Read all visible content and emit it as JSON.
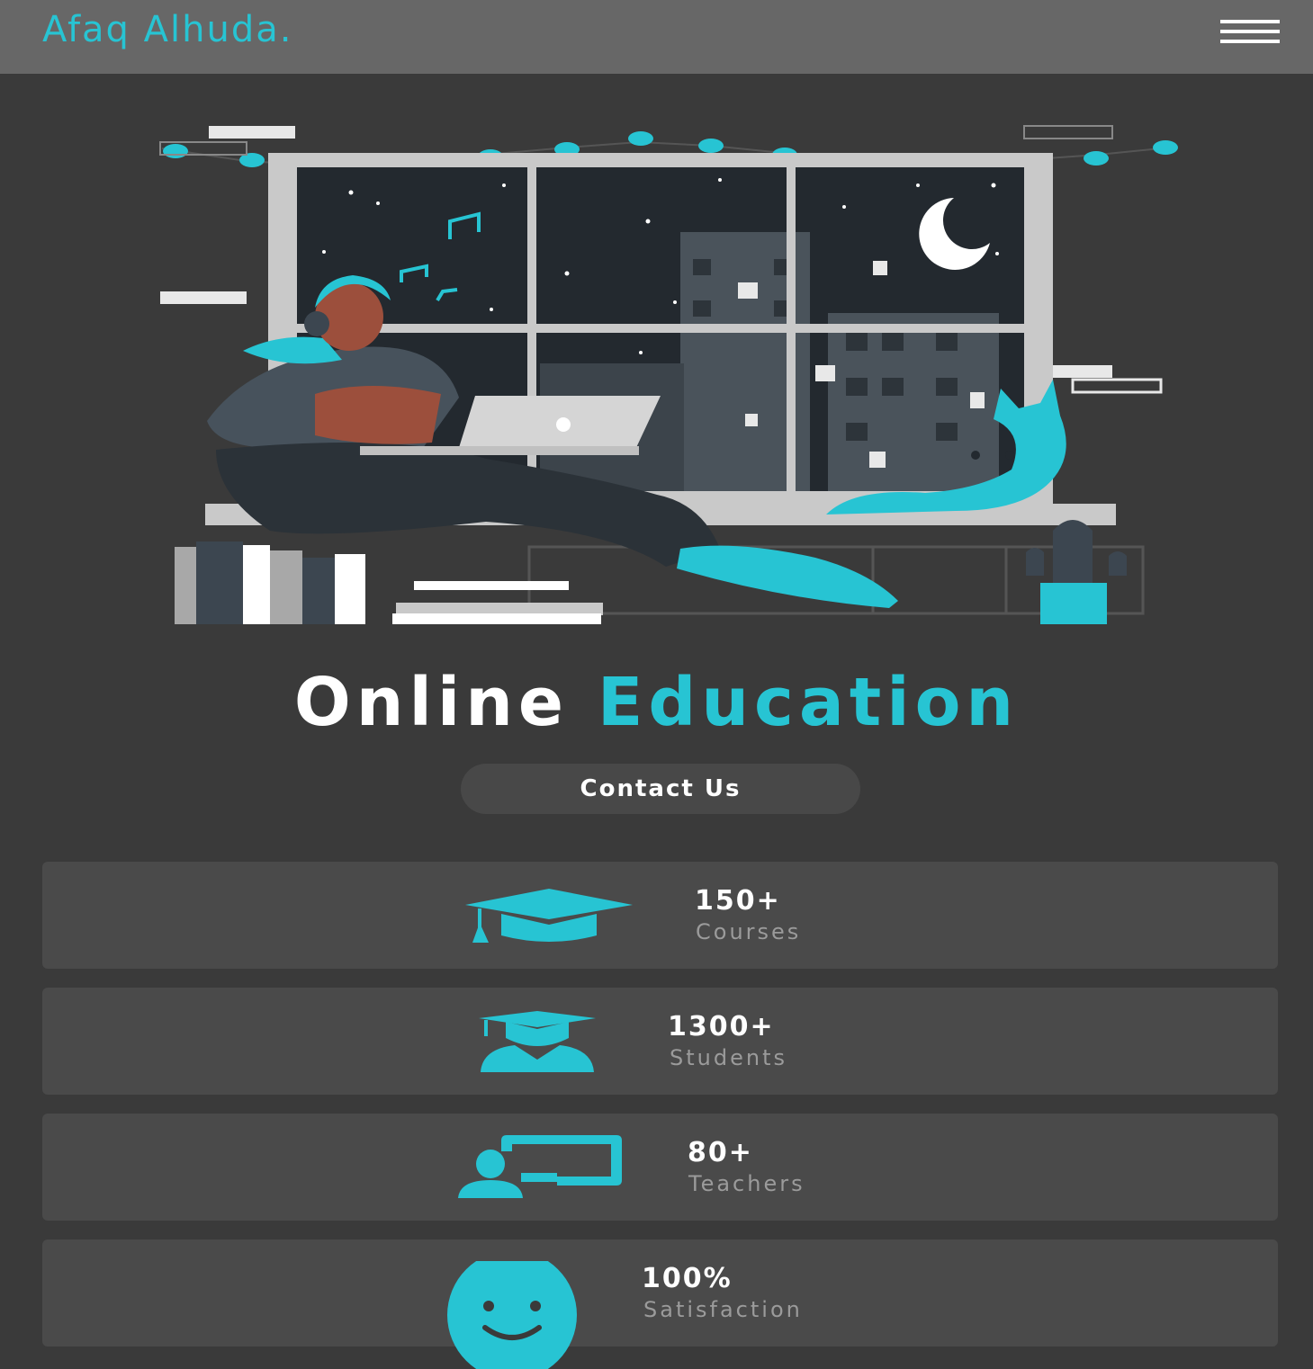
{
  "navbar": {
    "brand": "Afaq Alhuda.",
    "menu_icon": "hamburger-menu-icon"
  },
  "hero": {
    "illustration": "person-studying-laptop-window-night-illustration",
    "title_part1": "Online",
    "title_part2": "Education",
    "contact_label": "Contact Us"
  },
  "stats": [
    {
      "value": "150+",
      "label": "Courses",
      "icon": "graduation-cap-icon"
    },
    {
      "value": "1300+",
      "label": "Students",
      "icon": "student-graduate-icon"
    },
    {
      "value": "80+",
      "label": "Teachers",
      "icon": "teacher-board-icon"
    },
    {
      "value": "100%",
      "label": "Satisfaction",
      "icon": "smiley-face-icon"
    }
  ],
  "colors": {
    "accent": "#27c4d3",
    "background": "#3a3a3a",
    "navbar": "#676767",
    "card": "#4a4a4a"
  }
}
